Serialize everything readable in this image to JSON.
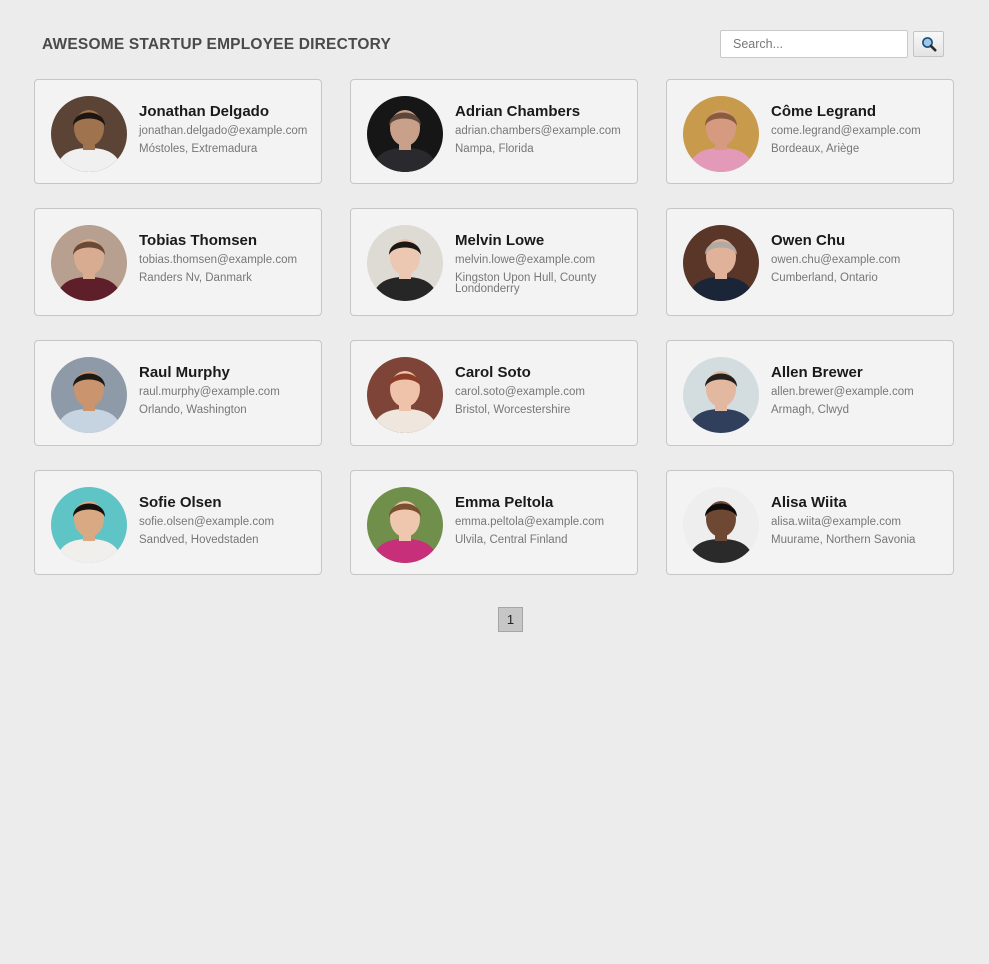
{
  "app": {
    "title": "AWESOME STARTUP EMPLOYEE DIRECTORY"
  },
  "search": {
    "placeholder": "Search...",
    "icon": "magnifying-glass-icon"
  },
  "employees": [
    {
      "name": "Jonathan Delgado",
      "email": "jonathan.delgado@example.com",
      "location": "Móstoles, Extremadura",
      "bg": "#5b4436",
      "skin": "#a0734f",
      "hair": "#1c1510",
      "shirt": "#f0f0f0"
    },
    {
      "name": "Adrian Chambers",
      "email": "adrian.chambers@example.com",
      "location": "Nampa, Florida",
      "bg": "#161616",
      "skin": "#c9a18a",
      "hair": "#5a463a",
      "shirt": "#2a2a2e"
    },
    {
      "name": "Côme Legrand",
      "email": "come.legrand@example.com",
      "location": "Bordeaux, Ariège",
      "bg": "#c79a4c",
      "skin": "#d69a80",
      "hair": "#8a5c3e",
      "shirt": "#e29ab8"
    },
    {
      "name": "Tobias Thomsen",
      "email": "tobias.thomsen@example.com",
      "location": "Randers Nv, Danmark",
      "bg": "#b7a08f",
      "skin": "#d8ac90",
      "hair": "#6b4a35",
      "shirt": "#5e1f2b"
    },
    {
      "name": "Melvin Lowe",
      "email": "melvin.lowe@example.com",
      "location": "Kingston Upon Hull, County Londonderry",
      "bg": "#dedad4",
      "skin": "#ecc7b1",
      "hair": "#1b1714",
      "shirt": "#262626"
    },
    {
      "name": "Owen Chu",
      "email": "owen.chu@example.com",
      "location": "Cumberland, Ontario",
      "bg": "#5a3628",
      "skin": "#e0b29a",
      "hair": "#b0aaa3",
      "shirt": "#1b2538"
    },
    {
      "name": "Raul Murphy",
      "email": "raul.murphy@example.com",
      "location": "Orlando, Washington",
      "bg": "#8e9aa8",
      "skin": "#c9946e",
      "hair": "#1d1915",
      "shirt": "#c6d3e0"
    },
    {
      "name": "Carol Soto",
      "email": "carol.soto@example.com",
      "location": "Bristol, Worcestershire",
      "bg": "#7e4438",
      "skin": "#efc3aa",
      "hair": "#8b3d28",
      "shirt": "#efe7de"
    },
    {
      "name": "Allen Brewer",
      "email": "allen.brewer@example.com",
      "location": "Armagh, Clwyd",
      "bg": "#d3dde0",
      "skin": "#e2b8a0",
      "hair": "#26201c",
      "shirt": "#30405c"
    },
    {
      "name": "Sofie Olsen",
      "email": "sofie.olsen@example.com",
      "location": "Sandved, Hovedstaden",
      "bg": "#5fc4c6",
      "skin": "#d9a984",
      "hair": "#15110e",
      "shirt": "#f1efec"
    },
    {
      "name": "Emma Peltola",
      "email": "emma.peltola@example.com",
      "location": "Ulvila, Central Finland",
      "bg": "#6f8f4a",
      "skin": "#efc6ae",
      "hair": "#7a5130",
      "shirt": "#c72f7a"
    },
    {
      "name": "Alisa Wiita",
      "email": "alisa.wiita@example.com",
      "location": "Muurame, Northern Savonia",
      "bg": "#eeeeee",
      "skin": "#6e4833",
      "hair": "#0e0c0b",
      "shirt": "#2a2a2a"
    }
  ],
  "pagination": {
    "current": "1"
  }
}
